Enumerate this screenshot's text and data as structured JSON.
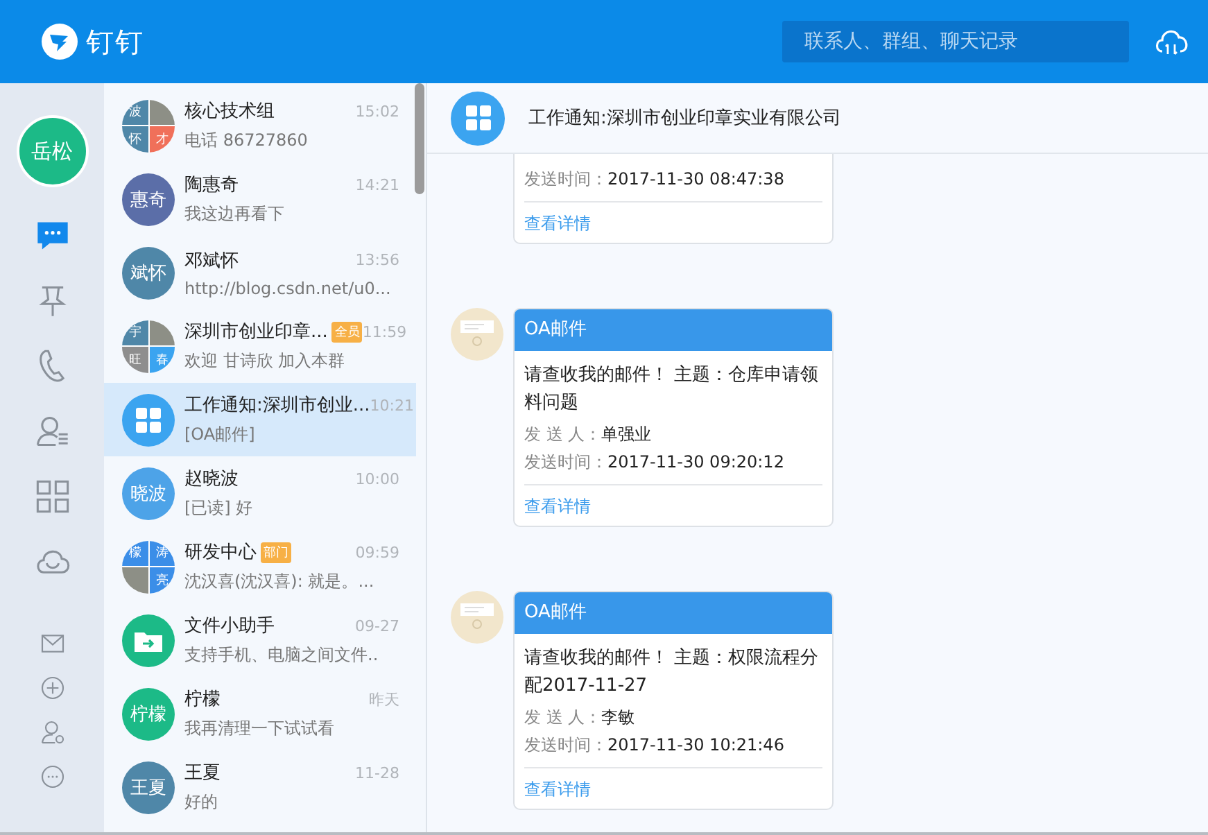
{
  "header": {
    "app_name": "钉钉",
    "search": {
      "placeholder": "联系人、群组、聊天记录"
    }
  },
  "sidebar": {
    "user": {
      "name": "岳松"
    },
    "items": [
      {
        "kind": "chat",
        "selected": true
      },
      {
        "kind": "pin",
        "selected": false
      },
      {
        "kind": "phone",
        "selected": false
      },
      {
        "kind": "contacts",
        "selected": false
      },
      {
        "kind": "apps",
        "selected": false
      },
      {
        "kind": "cloud",
        "selected": false
      }
    ],
    "bottom_items": [
      {
        "kind": "mail"
      },
      {
        "kind": "add"
      },
      {
        "kind": "user-settings"
      },
      {
        "kind": "more"
      }
    ]
  },
  "conversations": [
    {
      "name": "核心技术组",
      "time": "15:02",
      "preview": "电话 86727860",
      "selected": false,
      "avatar": {
        "kind": "grid",
        "cells": [
          {
            "text": "波",
            "color": "#4f87a8"
          },
          {
            "kind": "photo"
          },
          {
            "text": "怀",
            "color": "#4f87a8"
          },
          {
            "text": "才",
            "color": "#f0705a"
          }
        ]
      }
    },
    {
      "name": "陶惠奇",
      "time": "14:21",
      "preview": "我这边再看下",
      "selected": false,
      "avatar": {
        "kind": "text",
        "text": "惠奇",
        "color": "#5b6ea8"
      }
    },
    {
      "name": "邓斌怀",
      "time": "13:56",
      "preview": "http://blog.csdn.net/u0...",
      "selected": false,
      "avatar": {
        "kind": "text",
        "text": "斌怀",
        "color": "#4f87a8"
      }
    },
    {
      "name": "深圳市创业印章...",
      "badge": "全员",
      "time": "11:59",
      "preview": "欢迎 甘诗欣 加入本群",
      "selected": false,
      "avatar": {
        "kind": "grid",
        "cells": [
          {
            "text": "宇",
            "color": "#4f87a8"
          },
          {
            "kind": "photo"
          },
          {
            "text": "旺",
            "color": "#8e8e8e"
          },
          {
            "text": "春",
            "color": "#3ba4f0"
          }
        ]
      }
    },
    {
      "name": "工作通知:深圳市创业...",
      "time": "10:21",
      "preview": "[OA邮件]",
      "selected": true,
      "avatar": {
        "kind": "apps",
        "color": "#3ba4f0"
      }
    },
    {
      "name": "赵晓波",
      "time": "10:00",
      "preview": "[已读] 好",
      "selected": false,
      "avatar": {
        "kind": "text",
        "text": "晓波",
        "color": "#4da3e8"
      }
    },
    {
      "name": "研发中心",
      "badge": "部门",
      "time": "09:59",
      "preview": "沈汉喜(沈汉喜): 就是。...",
      "selected": false,
      "avatar": {
        "kind": "grid",
        "cells": [
          {
            "text": "檬",
            "color": "#3b8ee8"
          },
          {
            "text": "涛",
            "color": "#3b8ee8"
          },
          {
            "kind": "photo"
          },
          {
            "text": "亮",
            "color": "#3b8ee8"
          }
        ]
      }
    },
    {
      "name": "文件小助手",
      "time": "09-27",
      "preview": "支持手机、电脑之间文件..",
      "selected": false,
      "avatar": {
        "kind": "folder",
        "color": "#1cba87"
      }
    },
    {
      "name": "柠檬",
      "time": "昨天",
      "preview": "我再清理一下试试看",
      "selected": false,
      "avatar": {
        "kind": "text",
        "text": "柠檬",
        "color": "#1cba87"
      }
    },
    {
      "name": "王夏",
      "time": "11-28",
      "preview": "好的",
      "selected": false,
      "avatar": {
        "kind": "text",
        "text": "王夏",
        "color": "#4f87a8"
      }
    }
  ],
  "chat": {
    "title": "工作通知:深圳市创业印章实业有限公司",
    "messages": [
      {
        "clipped": true,
        "fields": [
          {
            "label": "发送时间：",
            "value": "2017-11-30 08:47:38"
          }
        ],
        "link": "查看详情"
      },
      {
        "clipped": false,
        "title": "OA邮件",
        "body": "请查收我的邮件！ 主题：仓库申请领料问题",
        "fields": [
          {
            "label": "发 送 人：",
            "value": "单强业"
          },
          {
            "label": "发送时间：",
            "value": "2017-11-30 09:20:12"
          }
        ],
        "link": "查看详情"
      },
      {
        "clipped": false,
        "title": "OA邮件",
        "body": "请查收我的邮件！ 主题：权限流程分配2017-11-27",
        "fields": [
          {
            "label": "发 送 人：",
            "value": "李敏"
          },
          {
            "label": "发送时间：",
            "value": "2017-11-30 10:21:46"
          }
        ],
        "link": "查看详情"
      }
    ]
  }
}
